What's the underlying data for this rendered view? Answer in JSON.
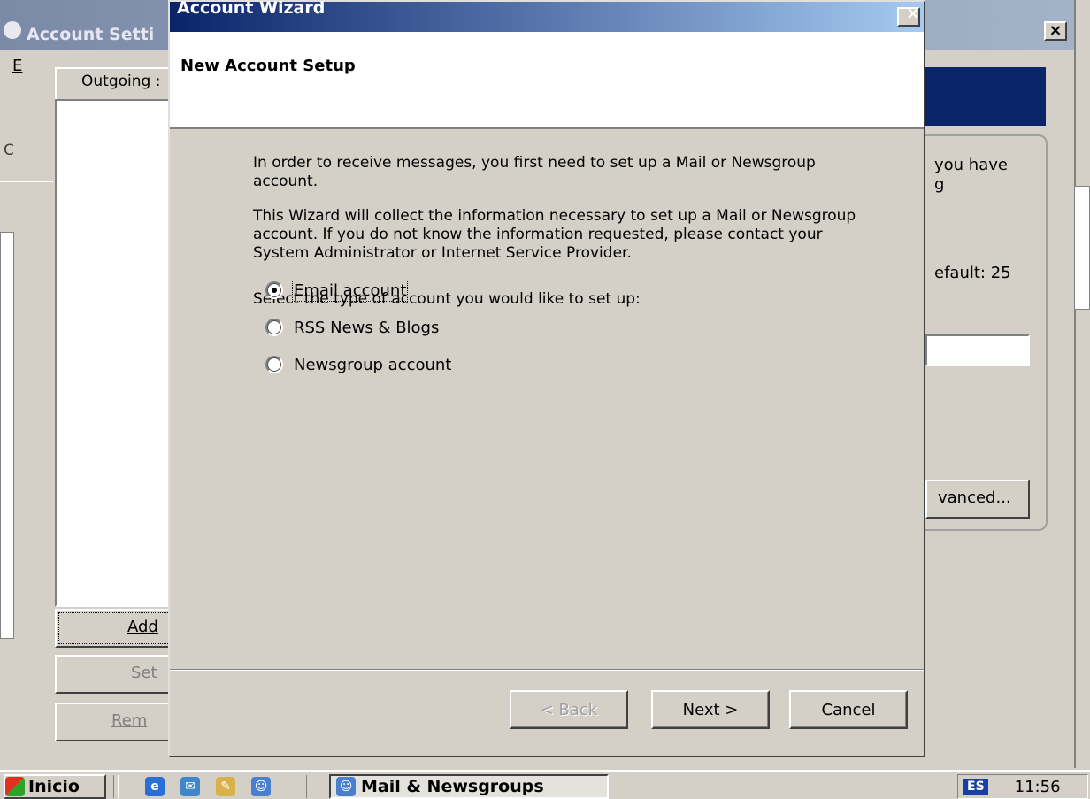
{
  "background": {
    "account_settings_title": "Account Setti",
    "menu_letter": "E",
    "outgoing_label": "Outgoing :",
    "left_letter": "C",
    "add_button": "Add",
    "set_button": "Set",
    "remove_button": "Rem",
    "right_text_1": "you have",
    "right_text_2": "g",
    "right_text_3": "efault:   25",
    "advanced_button": "vanced..."
  },
  "wizard": {
    "title": "Account Wizard",
    "close": "×",
    "header_title": "New Account Setup",
    "para1": "In order to receive messages, you first need to set up a Mail or Newsgroup account.",
    "para2": "This Wizard will collect the information necessary to set up a Mail or Newsgroup account. If you do not know the information requested, please contact your System Administrator or Internet Service Provider.",
    "para3": "Select the type of account you would like to set up:",
    "options": [
      {
        "label": "Email account",
        "selected": true
      },
      {
        "label": "RSS News & Blogs",
        "selected": false
      },
      {
        "label": "Newsgroup account",
        "selected": false
      }
    ],
    "back_button": "< Back",
    "next_button": "Next >",
    "cancel_button": "Cancel"
  },
  "taskbar": {
    "start_label": "Inicio",
    "task_label": "Mail & Newsgroups",
    "language": "ES",
    "clock": "11:56"
  },
  "colors": {
    "face": "#d4d0c8",
    "active_title": "#0a246a",
    "inactive_title": "#7b8aa7"
  }
}
